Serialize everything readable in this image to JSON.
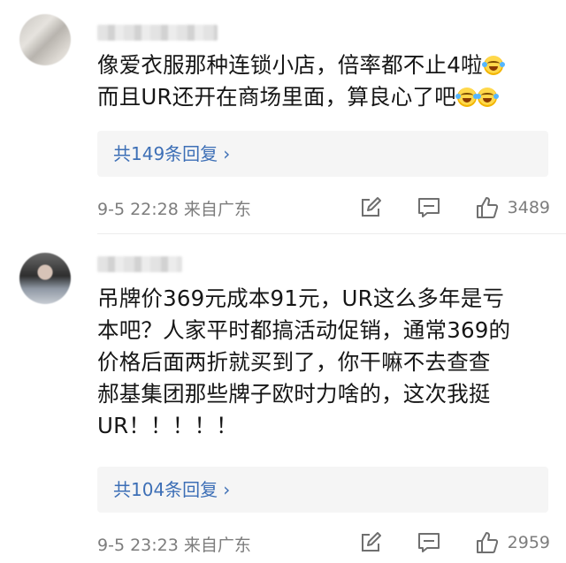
{
  "comments": [
    {
      "text_lines": [
        "像爱衣服那种连锁小店，倍率都不止4啦",
        "而且UR还开在商场里面，算良心了吧"
      ],
      "replies_label": "共149条回复",
      "time": "9-5 22:28",
      "location": "来自广东",
      "likes": "3489",
      "emoji": "laugh-cry"
    },
    {
      "text_lines": [
        "吊牌价369元成本91元，UR这么多年是亏",
        "本吧？人家平时都搞活动促销，通常369的",
        "价格后面两折就买到了，你干嘛不去查查",
        "郝基集团那些牌子欧时力啥的，这次我挺",
        "UR！！！！！"
      ],
      "replies_label": "共104条回复",
      "time": "9-5 23:23",
      "location": "来自广东",
      "likes": "2959"
    }
  ],
  "icons": {
    "share": "share-edit-icon",
    "comment": "comment-icon",
    "like": "thumbs-up-icon",
    "chevron": "chevron-right-icon"
  },
  "colors": {
    "link": "#3d6fb6",
    "meta": "#7d7d7d",
    "reply_bg": "#f5f5f5"
  }
}
